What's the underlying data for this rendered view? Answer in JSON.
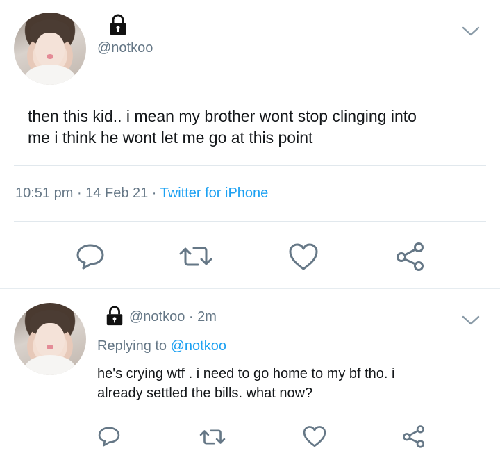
{
  "main_tweet": {
    "handle": "@notkoo",
    "text_line1": "then this kid.. i mean my brother wont stop clinging into",
    "text_line2": "me i think he wont let me go at this point",
    "time": "10:51 pm",
    "sep1": " · ",
    "date": "14 Feb 21",
    "sep2": " · ",
    "source": "Twitter for iPhone"
  },
  "reply_tweet": {
    "handle": "@notkoo",
    "age": " · 2m",
    "replying_prefix": "Replying to ",
    "replying_handle": "@notkoo",
    "text_line1": "he's crying wtf . i need to go home to my bf tho. i",
    "text_line2": "already settled the bills. what now?"
  },
  "icons": {
    "lock": "lock-icon",
    "chevron": "chevron-down-icon",
    "reply": "reply-icon",
    "retweet": "retweet-icon",
    "like": "heart-icon",
    "share": "share-icon"
  },
  "colors": {
    "link": "#1da1f2",
    "secondary_text": "#657786",
    "action_icon": "#657786"
  }
}
